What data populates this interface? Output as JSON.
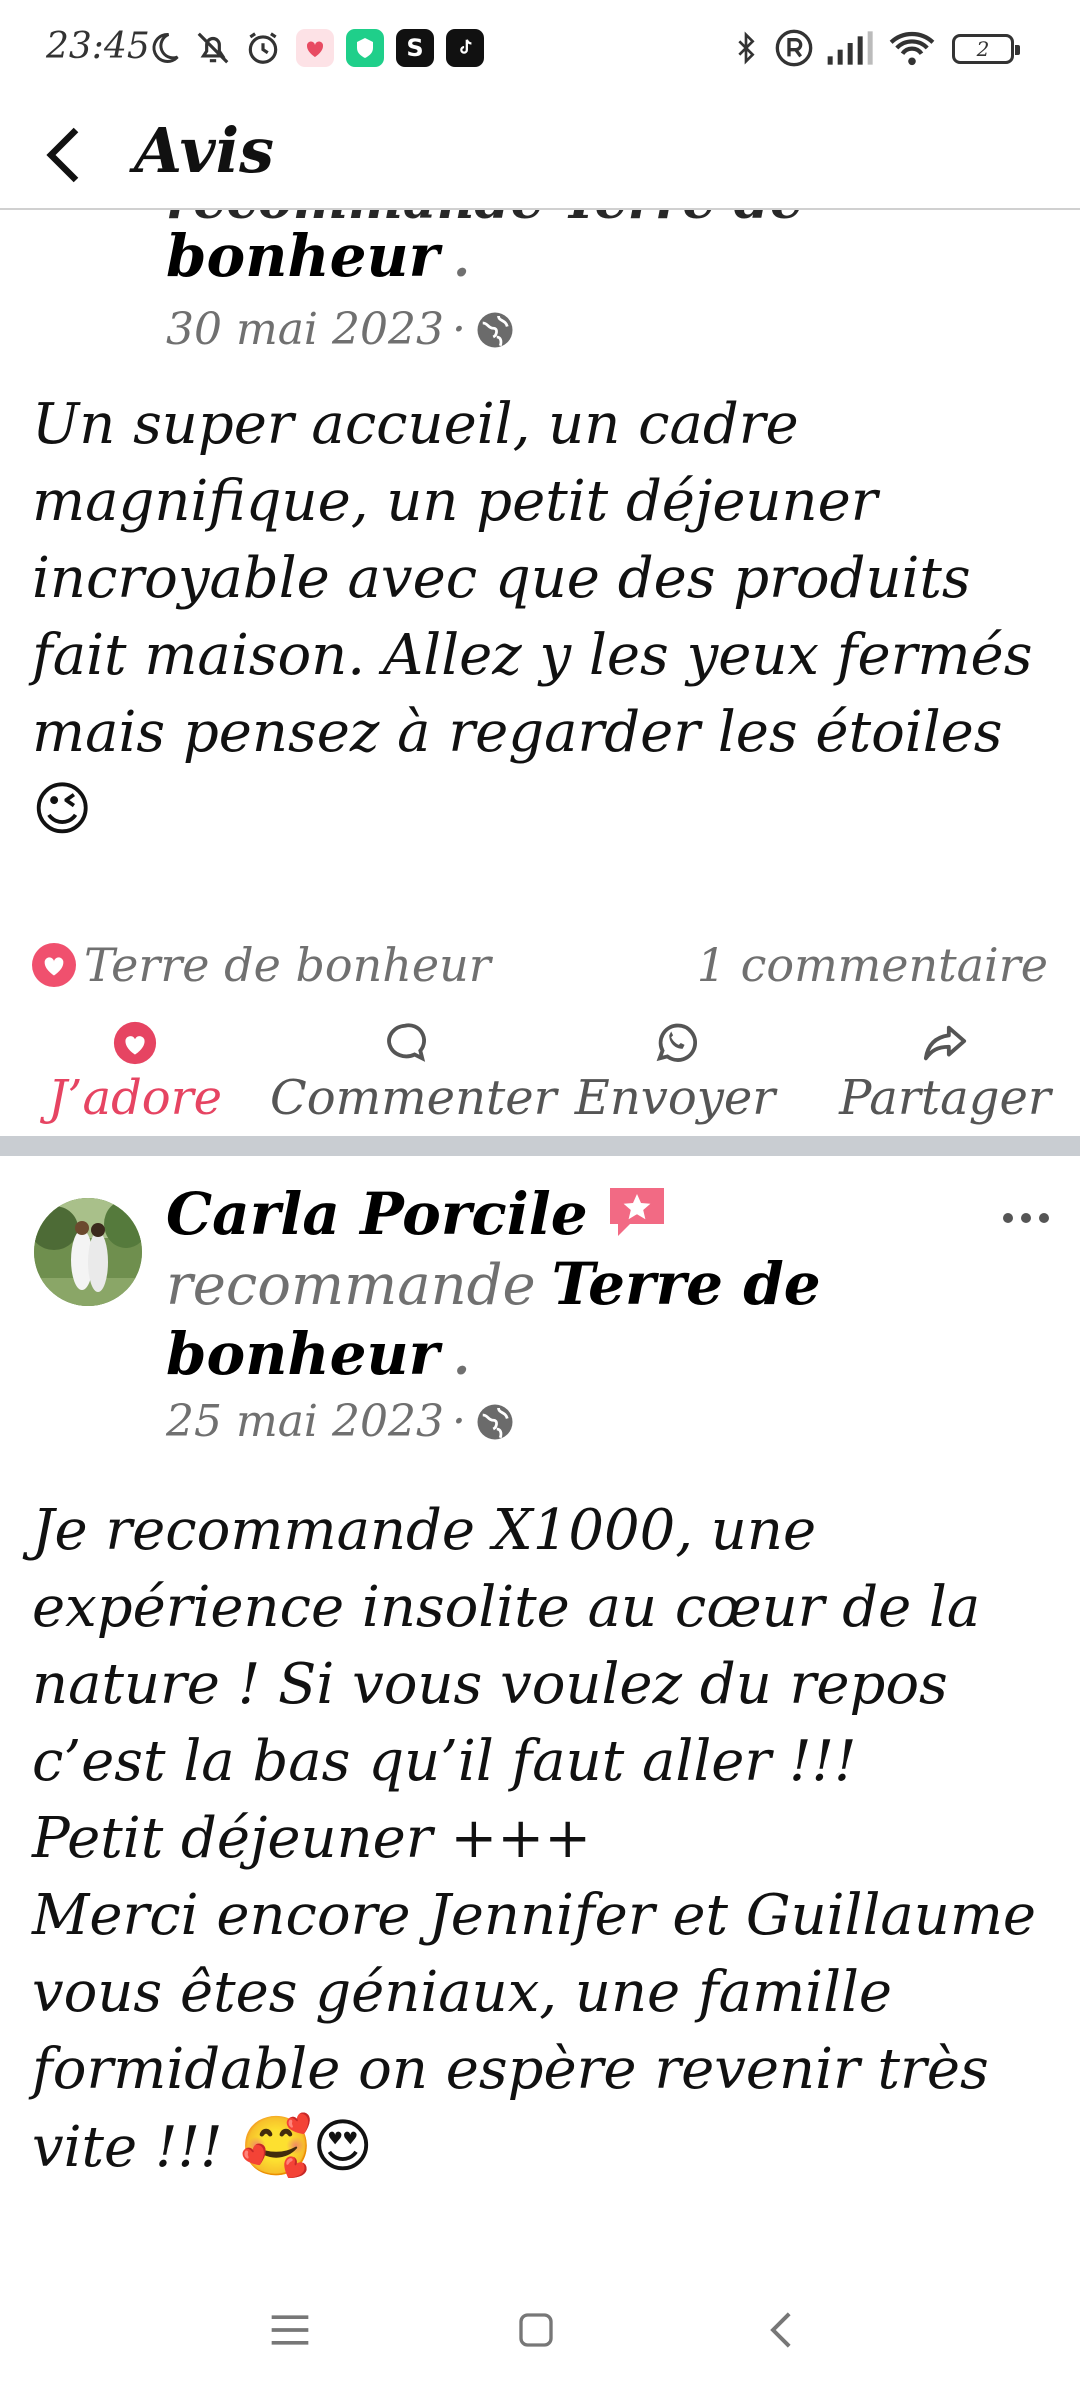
{
  "status_bar": {
    "time": "23:45",
    "battery": "2",
    "icons": [
      "moon-icon",
      "bell-off-icon",
      "alarm-icon",
      "app-heart-icon",
      "app-shield-icon",
      "app-s-icon",
      "tiktok-icon",
      "bluetooth-icon",
      "registered-icon",
      "signal-icon",
      "wifi-icon",
      "battery-icon"
    ]
  },
  "header": {
    "title": "Avis"
  },
  "post1": {
    "clipped_text": "recommande Terre de",
    "page_name_cont": "bonheur",
    "dot": ".",
    "date": "30 mai 2023",
    "date_sep": "·",
    "body": "Un super accueil, un cadre\nmagnifique, un petit déjeuner\nincroyable avec que des produits\nfait maison. Allez y les yeux fermés\nmais pensez à regarder les étoiles",
    "body_emoji": "😉",
    "reaction_name": "Terre de bonheur",
    "comments": "1 commentaire",
    "actions": {
      "like": "J’adore",
      "comment": "Commenter",
      "send": "Envoyer",
      "share": "Partager"
    }
  },
  "post2": {
    "author": "Carla Porcile",
    "recommends": "recommande",
    "page_name_a": "Terre de",
    "page_name_b": "bonheur",
    "dot": ".",
    "date": "25 mai 2023",
    "date_sep": "·",
    "body": "Je recommande X1000, une\nexpérience insolite au cœur de la\nnature ! Si vous voulez du repos\nc’est la bas qu’il faut aller !!!\nPetit déjeuner +++\nMerci encore Jennifer et Guillaume\nvous êtes géniaux, une famille\nformidable on espère revenir très\nvite !!!",
    "body_emojis": "🥰😍"
  },
  "colors": {
    "accent_like": "#e64462",
    "heart_badge": "#f0506e",
    "separator": "#c9cdd2",
    "muted": "#707070"
  }
}
